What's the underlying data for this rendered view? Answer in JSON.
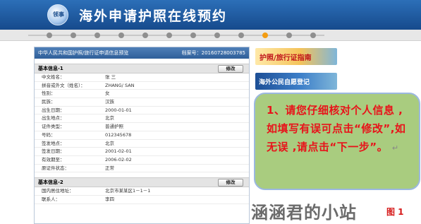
{
  "header": {
    "logo_text": "领事",
    "title": "海外申请护照在线预约"
  },
  "steps": {
    "count": 12,
    "active_index": 9
  },
  "panel": {
    "title": "中华人民共和国护照/旅行证申请信息预览",
    "file_no": "档案号：20160728003785",
    "section1": {
      "title": "基本信息-1",
      "edit_label": "修改",
      "rows": [
        {
          "label": "中文姓名：",
          "value": "张 三"
        },
        {
          "label": "拼音或外文（姓名）：",
          "value": "ZHANG/ SAN"
        },
        {
          "label": "性别：",
          "value": "女"
        },
        {
          "label": "民族：",
          "value": "汉族"
        },
        {
          "label": "出生日期：",
          "value": "2000-01-01"
        },
        {
          "label": "出生地点：",
          "value": "北京"
        },
        {
          "label": "证件类型：",
          "value": "普通护照"
        },
        {
          "label": "号码：",
          "value": "012345678"
        },
        {
          "label": "签发地点：",
          "value": "北京"
        },
        {
          "label": "签发日期：",
          "value": "2001-02-01"
        },
        {
          "label": "有效期至：",
          "value": "2006-02-02"
        },
        {
          "label": "原证件状态：",
          "value": "正常"
        }
      ]
    },
    "section2": {
      "title": "基本信息-2",
      "edit_label": "修改",
      "rows": [
        {
          "label": "国内居住地址：",
          "value": "北京市某某区1－1－1"
        },
        {
          "label": "联系人：",
          "value": "李四"
        }
      ]
    }
  },
  "sidebar": {
    "banner1": "护照/旅行证指南",
    "banner2": "海外公民自愿登记"
  },
  "note": {
    "text": "1、请您仔细核对个人信息 ,如填写有误可点击“修改”,如无误 ,请点击“下一步”。",
    "return_mark": "↵"
  },
  "watermark": "涵涵君的小站",
  "figure_label": "图 1"
}
